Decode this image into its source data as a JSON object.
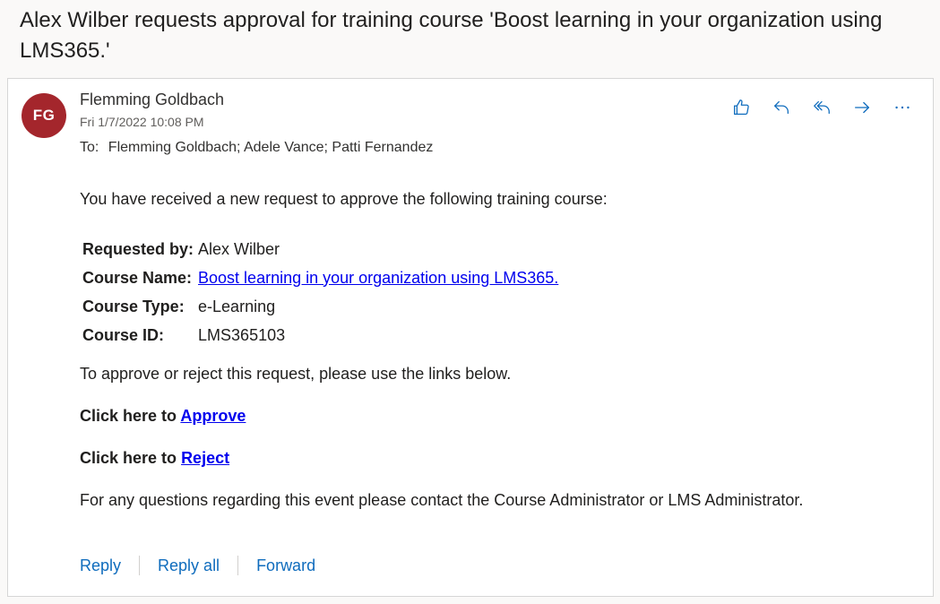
{
  "subject": "Alex Wilber requests approval for training course 'Boost learning in your organization using LMS365.'",
  "message": {
    "avatar_initials": "FG",
    "avatar_color": "#a4262c",
    "sender": "Flemming Goldbach",
    "date": "Fri 1/7/2022 10:08 PM",
    "to_label": "To:",
    "recipients": "Flemming Goldbach; Adele Vance; Patti Fernandez"
  },
  "actions": [
    "like-icon",
    "reply-icon",
    "reply-all-icon",
    "forward-icon",
    "more-icon"
  ],
  "body": {
    "intro": "You have received a new request to approve the following training course:",
    "requested_by_label": "Requested by:",
    "requested_by": "Alex Wilber",
    "course_name_label": "Course Name:",
    "course_name": "Boost learning in your organization using LMS365.",
    "course_type_label": "Course Type:",
    "course_type": "e-Learning",
    "course_id_label": "Course ID:",
    "course_id": "LMS365103",
    "approve_note": "To approve or reject this request, please use the links below.",
    "click_here": "Click here to",
    "approve": "Approve",
    "reject": "Reject",
    "footer": "For any questions regarding this event please contact the Course Administrator or LMS Administrator."
  },
  "reply_bar": {
    "reply": "Reply",
    "reply_all": "Reply all",
    "forward": "Forward"
  },
  "colors": {
    "accent": "#0f6cbd",
    "link": "#0000ee"
  }
}
